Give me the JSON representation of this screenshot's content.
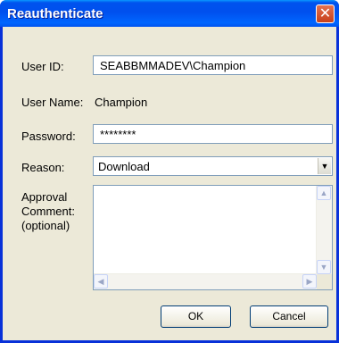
{
  "window": {
    "title": "Reauthenticate",
    "close_glyph": "✕"
  },
  "form": {
    "user_id_label": "User ID:",
    "user_id_value": "SEABBMMADEV\\Champion",
    "user_name_label": "User Name:",
    "user_name_value": "Champion",
    "password_label": "Password:",
    "password_value": "********",
    "reason_label": "Reason:",
    "reason_value": "Download",
    "comment_label_1": "Approval",
    "comment_label_2": "Comment:",
    "comment_label_3": "(optional)",
    "comment_value": ""
  },
  "scroll": {
    "up": "▲",
    "down": "▼",
    "left": "◀",
    "right": "▶",
    "dropdown": "▼"
  },
  "buttons": {
    "ok": "OK",
    "cancel": "Cancel"
  },
  "colors": {
    "titlebar": "#0053ee",
    "frame": "#0831d9",
    "dialog_bg": "#ece9d8",
    "close": "#c7401b"
  },
  "icons": {
    "close": "close-icon",
    "dropdown": "chevron-down-icon"
  }
}
